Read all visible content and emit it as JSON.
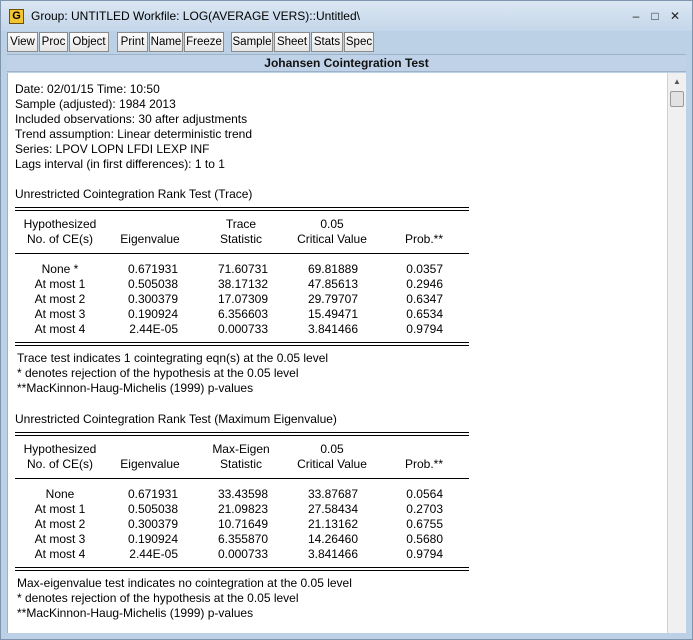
{
  "window": {
    "title": "Group: UNTITLED   Workfile: LOG(AVERAGE VERS)::Untitled\\",
    "app_icon_letter": "G",
    "minimize": "–",
    "maximize": "□",
    "close": "✕"
  },
  "toolbar": [
    "View",
    "Proc",
    "Object",
    "Print",
    "Name",
    "Freeze",
    "Sample",
    "Sheet",
    "Stats",
    "Spec"
  ],
  "header_title": "Johansen Cointegration Test",
  "info": [
    "Date: 02/01/15   Time: 10:50",
    "Sample (adjusted): 1984 2013",
    "Included observations: 30 after adjustments",
    "Trend assumption: Linear deterministic trend",
    "Series: LPOV LOPN LFDI LEXP INF",
    "Lags interval (in first differences): 1 to 1"
  ],
  "trace": {
    "title": "Unrestricted Cointegration Rank Test (Trace)",
    "headers": {
      "hyp1": "Hypothesized",
      "hyp2": "No. of CE(s)",
      "eig": "Eigenvalue",
      "stat1": "Trace",
      "stat2": "Statistic",
      "crit1": "0.05",
      "crit2": "Critical Value",
      "prob": "Prob.**"
    },
    "rows": [
      {
        "hyp": "None *",
        "eig": "0.671931",
        "stat": "71.60731",
        "crit": "69.81889",
        "prob": "0.0357"
      },
      {
        "hyp": "At most 1",
        "eig": "0.505038",
        "stat": "38.17132",
        "crit": "47.85613",
        "prob": "0.2946"
      },
      {
        "hyp": "At most 2",
        "eig": "0.300379",
        "stat": "17.07309",
        "crit": "29.79707",
        "prob": "0.6347"
      },
      {
        "hyp": "At most 3",
        "eig": "0.190924",
        "stat": "6.356603",
        "crit": "15.49471",
        "prob": "0.6534"
      },
      {
        "hyp": "At most 4",
        "eig": "2.44E-05",
        "stat": "0.000733",
        "crit": "3.841466",
        "prob": "0.9794"
      }
    ],
    "notes": [
      "Trace test indicates 1 cointegrating eqn(s) at the 0.05 level",
      " * denotes rejection of the hypothesis at the 0.05 level",
      " **MacKinnon-Haug-Michelis (1999) p-values"
    ]
  },
  "maxeig": {
    "title": "Unrestricted Cointegration Rank Test (Maximum Eigenvalue)",
    "headers": {
      "hyp1": "Hypothesized",
      "hyp2": "No. of CE(s)",
      "eig": "Eigenvalue",
      "stat1": "Max-Eigen",
      "stat2": "Statistic",
      "crit1": "0.05",
      "crit2": "Critical Value",
      "prob": "Prob.**"
    },
    "rows": [
      {
        "hyp": "None",
        "eig": "0.671931",
        "stat": "33.43598",
        "crit": "33.87687",
        "prob": "0.0564"
      },
      {
        "hyp": "At most 1",
        "eig": "0.505038",
        "stat": "21.09823",
        "crit": "27.58434",
        "prob": "0.2703"
      },
      {
        "hyp": "At most 2",
        "eig": "0.300379",
        "stat": "10.71649",
        "crit": "21.13162",
        "prob": "0.6755"
      },
      {
        "hyp": "At most 3",
        "eig": "0.190924",
        "stat": "6.355870",
        "crit": "14.26460",
        "prob": "0.5680"
      },
      {
        "hyp": "At most 4",
        "eig": "2.44E-05",
        "stat": "0.000733",
        "crit": "3.841466",
        "prob": "0.9794"
      }
    ],
    "notes": [
      "Max-eigenvalue test indicates no cointegration at the 0.05 level",
      " * denotes rejection of the hypothesis at the 0.05 level",
      " **MacKinnon-Haug-Michelis (1999) p-values"
    ]
  }
}
